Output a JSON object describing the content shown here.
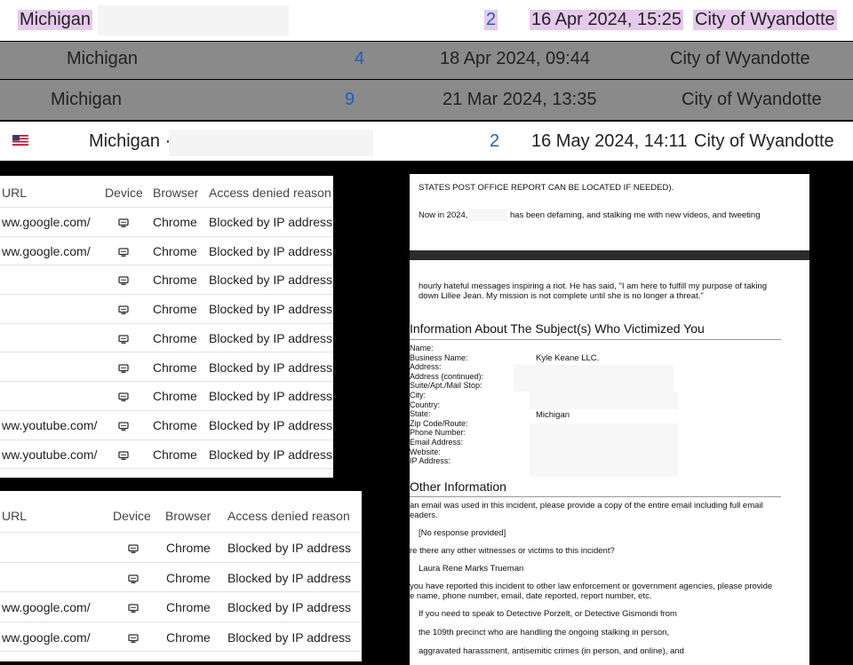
{
  "top_rows": [
    {
      "state": "Michigan",
      "count": "2",
      "date": "16 Apr 2024, 15:25",
      "city": "City of Wyandotte"
    },
    {
      "state": "Michigan",
      "count": "4",
      "date": "18 Apr 2024, 09:44",
      "city": "City of Wyandotte"
    },
    {
      "state": "Michigan",
      "count": "9",
      "date": "21 Mar 2024, 13:35",
      "city": "City of Wyandotte"
    },
    {
      "state": "Michigan ·",
      "count": "2",
      "date": "16 May 2024, 14:11",
      "city": "City of Wyandotte"
    }
  ],
  "table1": {
    "headers": {
      "url": "URL",
      "device": "Device",
      "browser": "Browser",
      "reason": "Access denied reason"
    },
    "rows": [
      {
        "url": "ww.google.com/",
        "browser": "Chrome",
        "reason": "Blocked by IP address"
      },
      {
        "url": "ww.google.com/",
        "browser": "Chrome",
        "reason": "Blocked by IP address"
      },
      {
        "url": "",
        "browser": "Chrome",
        "reason": "Blocked by IP address"
      },
      {
        "url": "",
        "browser": "Chrome",
        "reason": "Blocked by IP address"
      },
      {
        "url": "",
        "browser": "Chrome",
        "reason": "Blocked by IP address"
      },
      {
        "url": "",
        "browser": "Chrome",
        "reason": "Blocked by IP address"
      },
      {
        "url": "",
        "browser": "Chrome",
        "reason": "Blocked by IP address"
      },
      {
        "url": "ww.youtube.com/",
        "browser": "Chrome",
        "reason": "Blocked by IP address"
      },
      {
        "url": "ww.youtube.com/",
        "browser": "Chrome",
        "reason": "Blocked by IP address"
      }
    ]
  },
  "table2": {
    "headers": {
      "url": "URL",
      "device": "Device",
      "browser": "Browser",
      "reason": "Access denied reason"
    },
    "rows": [
      {
        "url": "",
        "browser": "Chrome",
        "reason": "Blocked by IP address"
      },
      {
        "url": "",
        "browser": "Chrome",
        "reason": "Blocked by IP address"
      },
      {
        "url": "ww.google.com/",
        "browser": "Chrome",
        "reason": "Blocked by IP address"
      },
      {
        "url": "ww.google.com/",
        "browser": "Chrome",
        "reason": "Blocked by IP address"
      }
    ]
  },
  "doc": {
    "line1": "STATES POST OFFICE REPORT CAN BE LOCATED IF NEEDED).",
    "line2a": "Now in 2024,",
    "line2b": "has been defaming, and stalking me with new videos, and tweeting",
    "para1": "hourly hateful messages inspiring a riot. He has said, \"I am here to fulfill my purpose of taking",
    "para2": "down Lillee Jean. My mission is not complete until she is no longer a threat.\"",
    "heading1": "Information About The Subject(s) Who Victimized You",
    "fields": [
      "Name:",
      "Business Name:",
      "Address:",
      "Address (continued):",
      "Suite/Apt./Mail Stop:",
      "City:",
      "Country:",
      "State:",
      "Zip Code/Route:",
      "Phone Number:",
      "Email Address:",
      "Website:",
      "IP Address:"
    ],
    "business_value": "Kyle Keane LLC.",
    "state_value": "Michigan",
    "heading2": "Other Information",
    "q1a": "an email was used in this incident, please provide a copy of the entire email including full email",
    "q1b": "eaders.",
    "a1": "[No response provided]",
    "q2": "re there any other witnesses or victims to this incident?",
    "a2": "Laura Rene Marks Trueman",
    "q3a": "you have reported this incident to other law enforcement or government agencies, please provide",
    "q3b": "e name, phone number, email, date reported, report number, etc.",
    "a3a": "If you need to speak to Detective Porzelt, or Detective Gismondi from",
    "a3b": "the 109th precinct who are handling the ongoing stalking in person,",
    "a3c": "aggravated harassment, antisemitic crimes (in person, and online), and"
  }
}
